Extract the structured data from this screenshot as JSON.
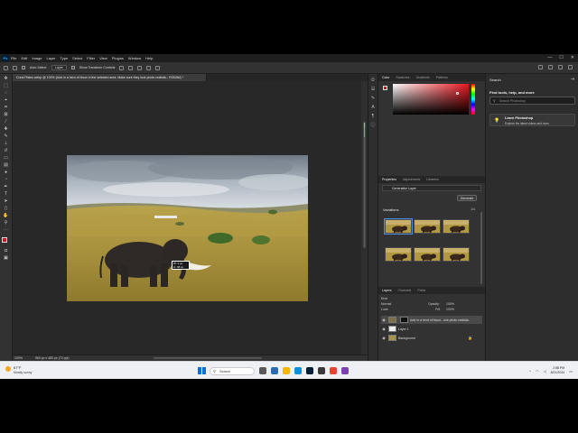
{
  "app": {
    "logo": "Ps",
    "menu": [
      "File",
      "Edit",
      "Image",
      "Layer",
      "Type",
      "Select",
      "Filter",
      "View",
      "Plugins",
      "Window",
      "Help"
    ],
    "window_controls": [
      "—",
      "☐",
      "✕"
    ]
  },
  "options_bar": {
    "auto_select_label": "Auto-Select:",
    "auto_select_value": "Layer",
    "transform_label": "Show Transform Controls"
  },
  "document_tab": {
    "title": "Coral Plains.webp @ 100% (Add in a herd of bison in the selected area. Make sure they look photo realistic., RGB/8#) *"
  },
  "canvas": {
    "selection_label_1": "W: 1 px",
    "selection_label_2": "H: 48 px"
  },
  "status_bar": {
    "zoom": "100%",
    "doc_info": "960 px x 480 px (72 ppi)"
  },
  "color_panel": {
    "tabs": [
      "Color",
      "Swatches",
      "Gradients",
      "Patterns"
    ],
    "active_tab": "Color",
    "foreground_color": "#c8161d"
  },
  "properties_panel": {
    "tabs": [
      "Properties",
      "Adjustments",
      "Libraries"
    ],
    "active_tab": "Properties",
    "layer_type": "Generative Layer",
    "generate_label": "Generate",
    "variations_label": "Variations",
    "variations_count": "1/4"
  },
  "layers_panel": {
    "tabs": [
      "Layers",
      "Channels",
      "Paths"
    ],
    "active_tab": "Layers",
    "filter_kind": "Kind",
    "blend_mode": "Normal",
    "opacity_label": "Opacity:",
    "opacity_value": "100%",
    "lock_label": "Lock:",
    "fill_label": "Fill:",
    "fill_value": "100%",
    "layers": [
      {
        "name": "Add in a herd of bison...ook photo realistic.",
        "selected": true
      },
      {
        "name": "Layer 1",
        "selected": false
      },
      {
        "name": "Background",
        "selected": false,
        "locked": true
      }
    ]
  },
  "search_panel": {
    "title": "Search",
    "heading": "Find tools, help, and more",
    "placeholder": "Search Photoshop",
    "learn_title": "Learn Photoshop",
    "learn_subtitle": "Explore the latest videos and tours"
  },
  "taskbar": {
    "weather_temp": "67°F",
    "weather_cond": "Mostly sunny",
    "search_label": "Search",
    "time": "2:58 PM",
    "date": "8/21/2024"
  }
}
